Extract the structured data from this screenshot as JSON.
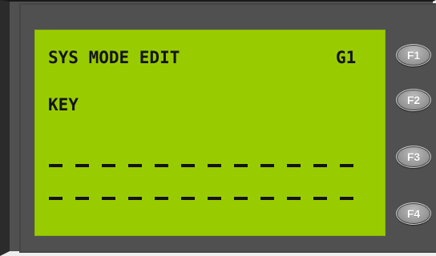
{
  "display": {
    "line1_left": "SYS MODE EDIT",
    "line1_right": "G1",
    "line2": "KEY",
    "entry_row_1": "_ _ _ _ _ _ _ _ _ _ _ _",
    "entry_row_2": "_ _ _ _ _ _ _ _ _ _ _ _",
    "background_color": "#99cc00",
    "text_color": "#141414"
  },
  "function_keys": [
    {
      "label": "F1"
    },
    {
      "label": "F2"
    },
    {
      "label": "F3"
    },
    {
      "label": "F4"
    }
  ],
  "colors": {
    "bezel": "#505050",
    "key": "#9a9a9a"
  }
}
